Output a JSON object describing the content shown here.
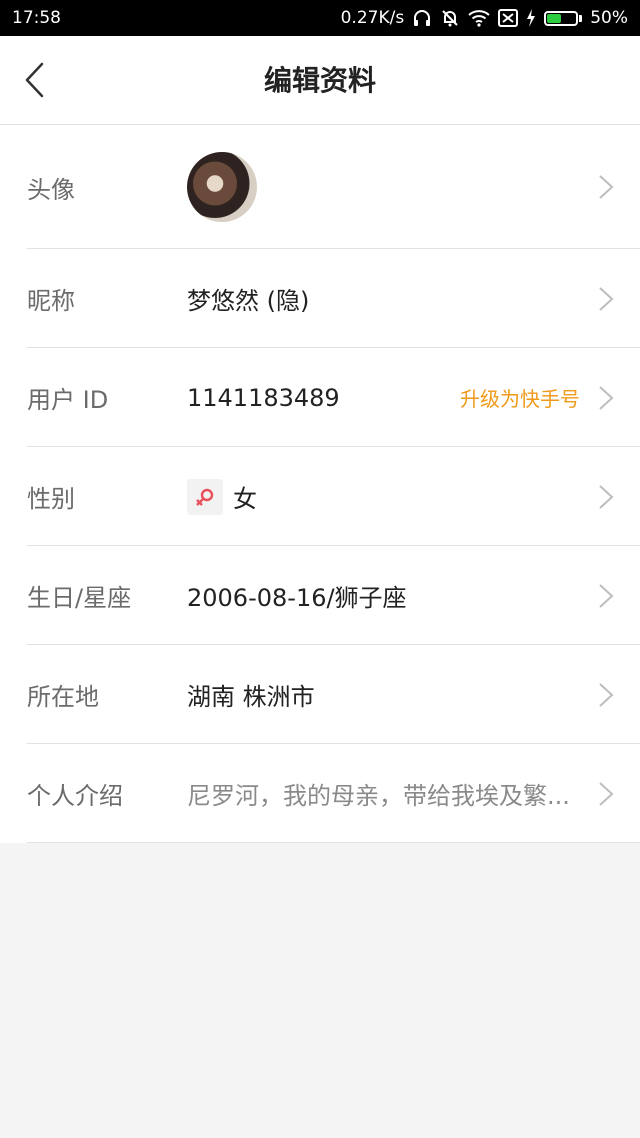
{
  "status_bar": {
    "time": "17:58",
    "net_speed": "0.27K/s",
    "battery_pct": "50%",
    "battery_level": 0.5,
    "icons": [
      "headphones-icon",
      "bell-off-icon",
      "wifi-icon",
      "sim-off-icon",
      "charging-icon",
      "battery-icon"
    ]
  },
  "header": {
    "title": "编辑资料",
    "back_icon": "chevron-left-icon"
  },
  "profile": {
    "avatar": {
      "label": "头像"
    },
    "nickname": {
      "label": "昵称",
      "value": "梦悠然 (隐)"
    },
    "user_id": {
      "label": "用户 ID",
      "value": "1141183489",
      "action": "升级为快手号"
    },
    "gender": {
      "label": "性别",
      "value": "女",
      "icon": "female-icon"
    },
    "birthday": {
      "label": "生日/星座",
      "value": "2006-08-16/狮子座"
    },
    "location": {
      "label": "所在地",
      "value": "湖南 株洲市"
    },
    "bio": {
      "label": "个人介绍",
      "value": "尼罗河，我的母亲，带给我埃及繁..."
    }
  },
  "colors": {
    "accent": "#f09a1a",
    "label": "#6b6b6b",
    "value": "#222222",
    "female_icon": "#e8505b"
  }
}
